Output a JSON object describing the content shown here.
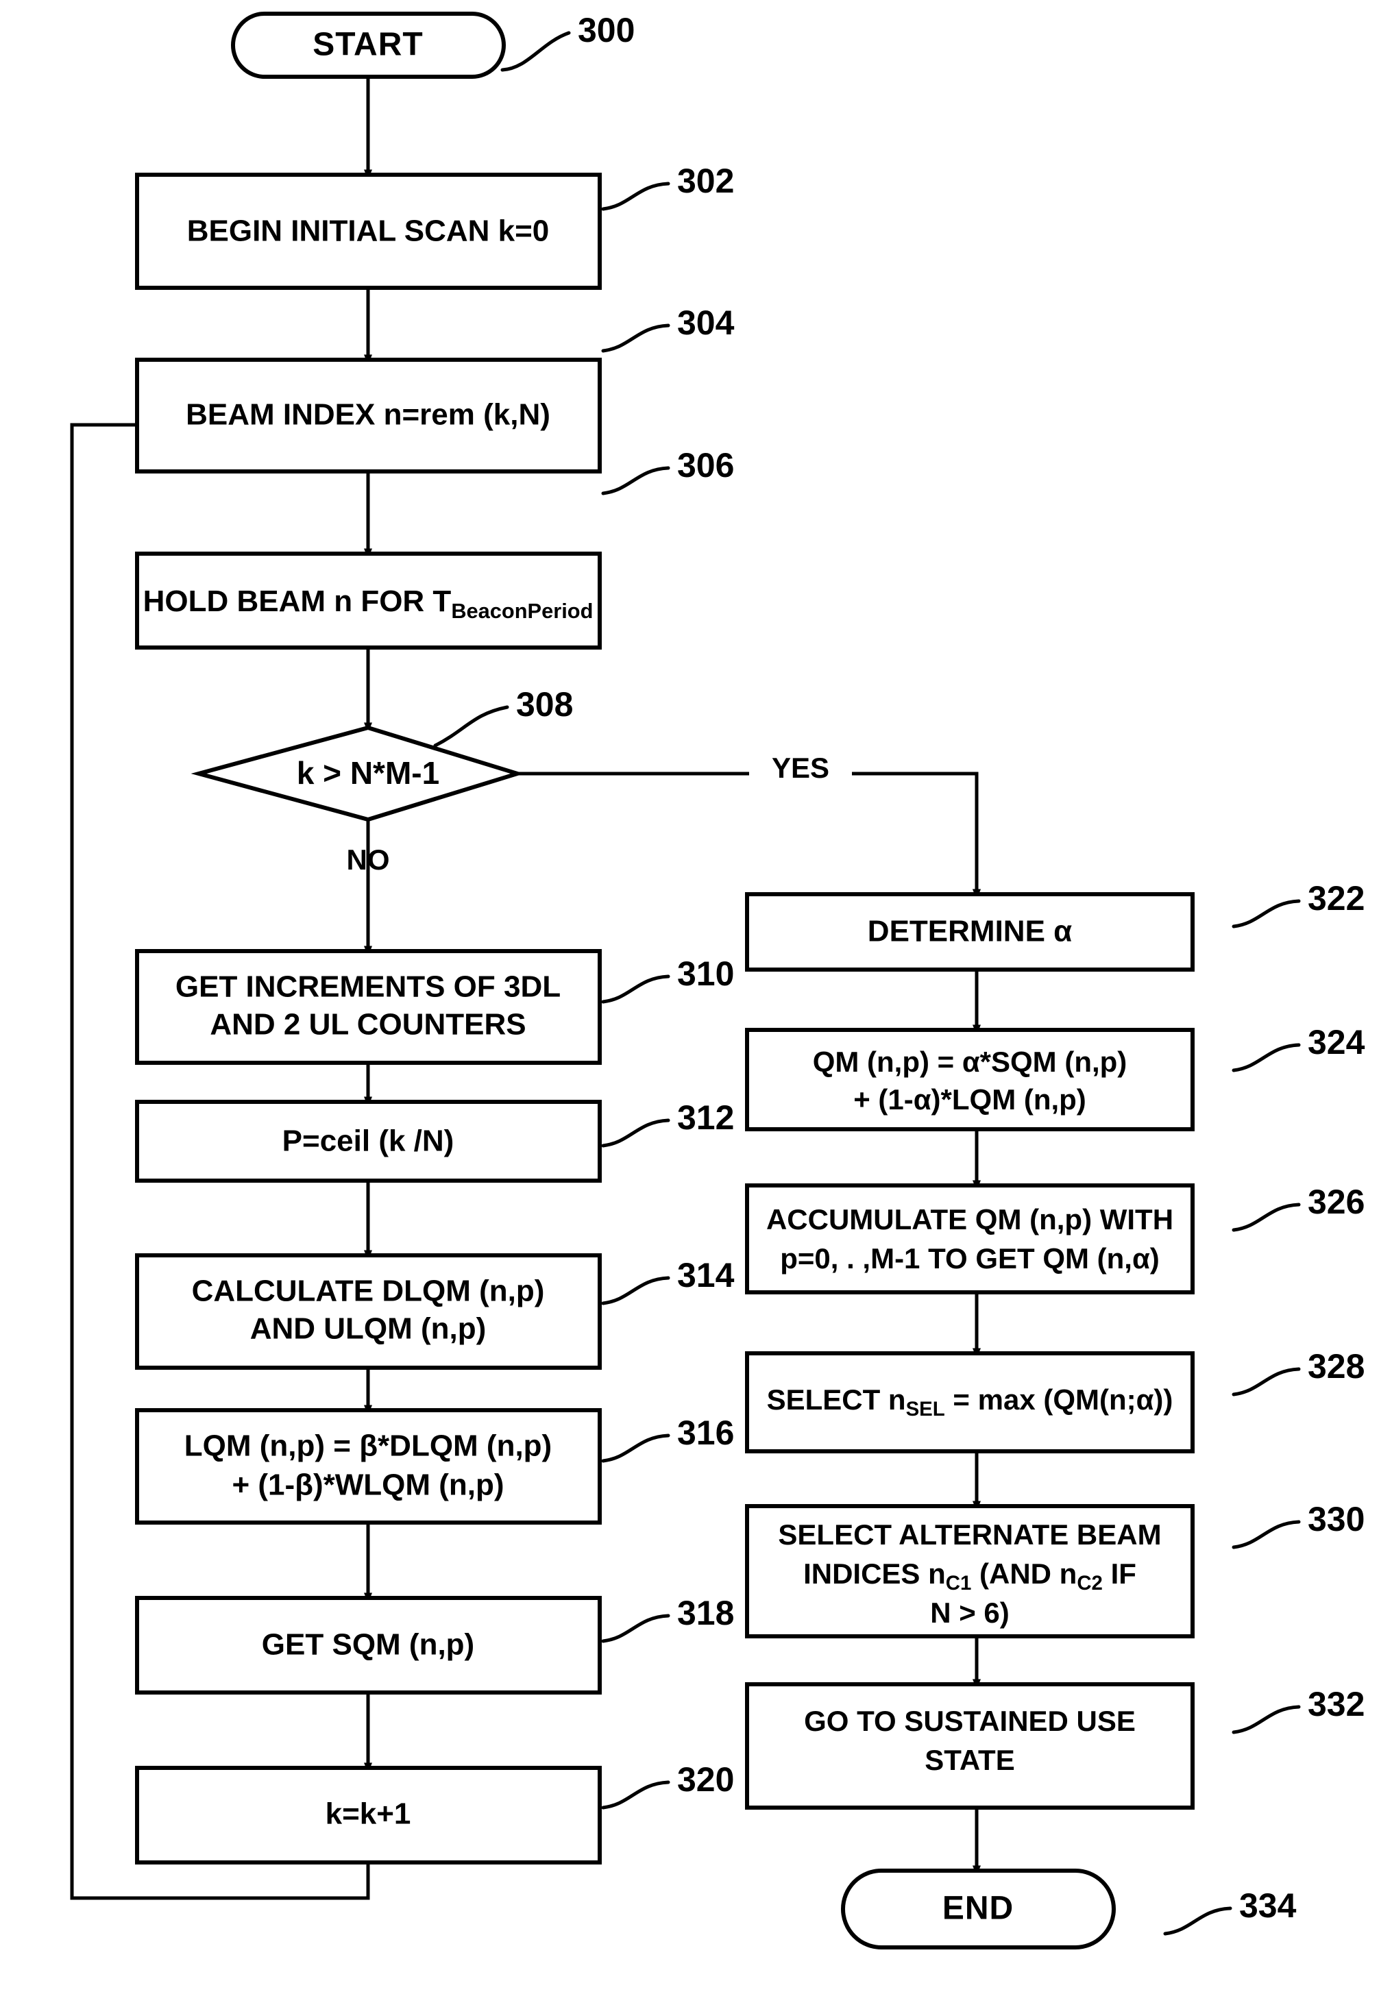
{
  "figure": {
    "kind": "patent-flowchart",
    "background_color": "#ffffff",
    "line_color": "#000000"
  },
  "nodes": {
    "start": {
      "ref": "300",
      "label": "START",
      "shape": "terminator"
    },
    "n302": {
      "ref": "302",
      "lines": [
        "BEGIN INITIAL SCAN k=0"
      ],
      "shape": "process"
    },
    "n304": {
      "ref": "304",
      "lines": [
        "BEAM INDEX n=rem (k,N)"
      ],
      "shape": "process"
    },
    "n306": {
      "ref": "306",
      "lines": [
        "HOLD BEAM n FOR T"
      ],
      "subscript": "BeaconPeriod",
      "shape": "process"
    },
    "n308": {
      "ref": "308",
      "lines": [
        "k > N*M-1"
      ],
      "shape": "decision"
    },
    "n310": {
      "ref": "310",
      "lines": [
        "GET INCREMENTS OF 3DL",
        "AND 2 UL COUNTERS"
      ],
      "shape": "process"
    },
    "n312": {
      "ref": "312",
      "lines": [
        "P=ceil (k /N)"
      ],
      "shape": "process"
    },
    "n314": {
      "ref": "314",
      "lines": [
        "CALCULATE DLQM (n,p)",
        "AND ULQM (n,p)"
      ],
      "shape": "process"
    },
    "n316": {
      "ref": "316",
      "lines": [
        "LQM (n,p) = β*DLQM (n,p)",
        "+ (1-β)*WLQM (n,p)"
      ],
      "shape": "process"
    },
    "n318": {
      "ref": "318",
      "lines": [
        "GET SQM (n,p)"
      ],
      "shape": "process"
    },
    "n320": {
      "ref": "320",
      "lines": [
        "k=k+1"
      ],
      "shape": "process"
    },
    "n322": {
      "ref": "322",
      "lines": [
        "DETERMINE α"
      ],
      "shape": "process"
    },
    "n324": {
      "ref": "324",
      "lines": [
        "QM (n,p) = α*SQM (n,p)",
        "+ (1-α)*LQM (n,p)"
      ],
      "shape": "process"
    },
    "n326": {
      "ref": "326",
      "lines": [
        "ACCUMULATE QM (n,p) WITH",
        "p=0, . ,M-1 TO GET QM (n,α)"
      ],
      "shape": "process"
    },
    "n328": {
      "ref": "328",
      "label_pre": "SELECT n",
      "label_sub": "SEL",
      "label_post": " = max (QM(n;α))",
      "shape": "process"
    },
    "n330": {
      "ref": "330",
      "line1": "SELECT ALTERNATE BEAM",
      "line2_a": "INDICES n",
      "line2_sub1": "C1",
      "line2_b": " (AND n",
      "line2_sub2": "C2",
      "line2_c": " IF",
      "line3": "N > 6)",
      "shape": "process"
    },
    "n332": {
      "ref": "332",
      "lines": [
        "GO TO SUSTAINED USE",
        "STATE"
      ],
      "shape": "process"
    },
    "end": {
      "ref": "334",
      "label": "END",
      "shape": "terminator"
    }
  },
  "edges": {
    "yes_label": "YES",
    "no_label": "NO"
  }
}
